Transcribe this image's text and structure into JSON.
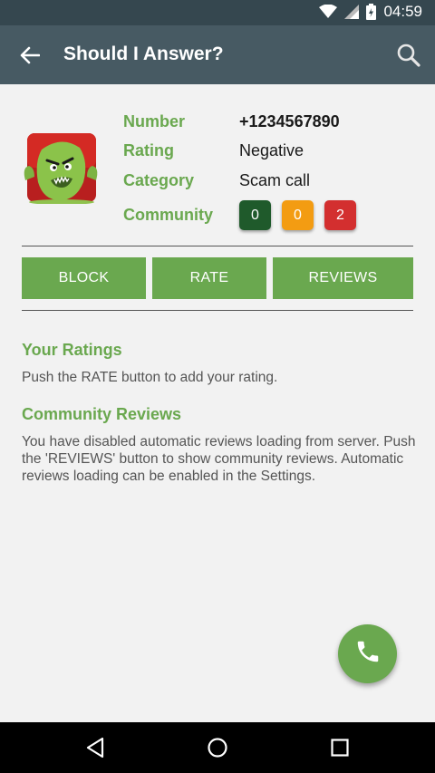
{
  "status_bar": {
    "time": "04:59"
  },
  "toolbar": {
    "title": "Should I Answer?"
  },
  "caller": {
    "number_label": "Number",
    "number_value": "+1234567890",
    "rating_label": "Rating",
    "rating_value": "Negative",
    "category_label": "Category",
    "category_value": "Scam call",
    "community_label": "Community",
    "community_counts": {
      "positive": "0",
      "neutral": "0",
      "negative": "2"
    }
  },
  "actions": {
    "block": "BLOCK",
    "rate": "RATE",
    "reviews": "REVIEWS"
  },
  "your_ratings": {
    "title": "Your Ratings",
    "text": "Push the RATE button to add your rating."
  },
  "community_reviews": {
    "title": "Community Reviews",
    "text": "You have disabled automatic reviews loading from server. Push the 'REVIEWS' button to show community reviews. Automatic reviews loading can be enabled in the Settings."
  },
  "colors": {
    "accent_green": "#6aa84f",
    "toolbar": "#475a63",
    "status_bar": "#35474f",
    "badge_positive": "#1f5a2b",
    "badge_neutral": "#f39c12",
    "badge_negative": "#d32f2f"
  },
  "icons": {
    "back": "arrow-back-icon",
    "search": "search-icon",
    "fab": "phone-icon",
    "nav_back": "nav-back-icon",
    "nav_home": "nav-home-icon",
    "nav_recents": "nav-recents-icon"
  }
}
